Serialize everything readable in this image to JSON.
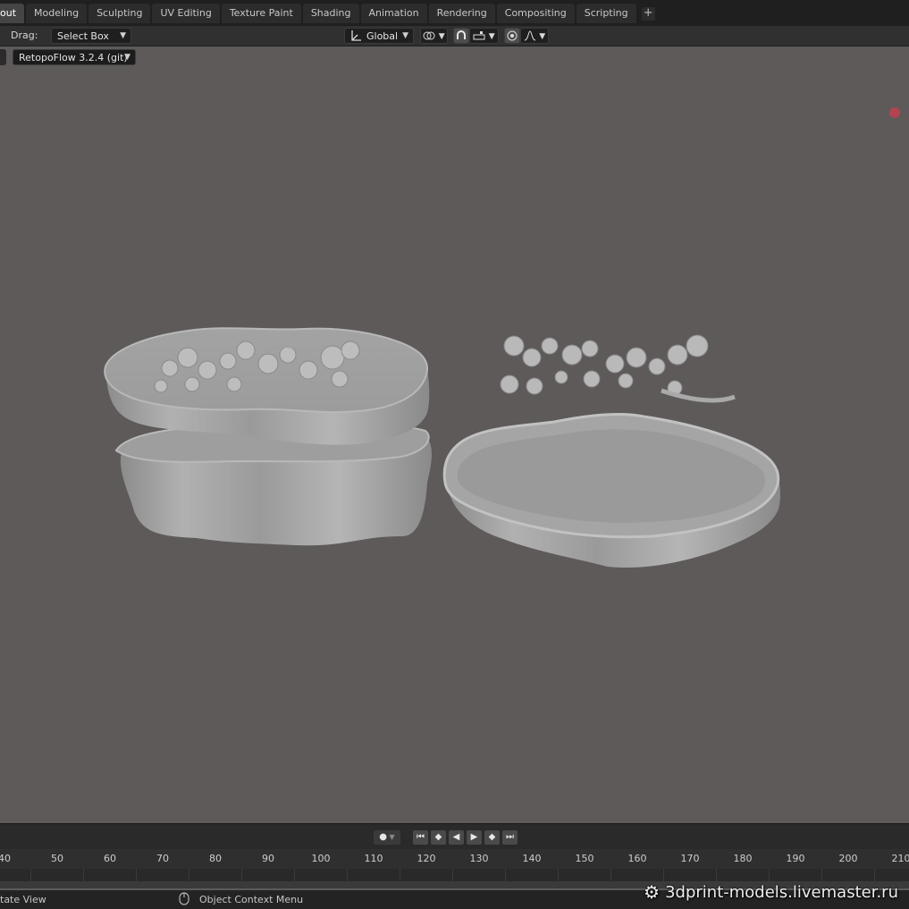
{
  "workspace_tabs": [
    {
      "label": "out",
      "active": true
    },
    {
      "label": "Modeling",
      "active": false
    },
    {
      "label": "Sculpting",
      "active": false
    },
    {
      "label": "UV Editing",
      "active": false
    },
    {
      "label": "Texture Paint",
      "active": false
    },
    {
      "label": "Shading",
      "active": false
    },
    {
      "label": "Animation",
      "active": false
    },
    {
      "label": "Rendering",
      "active": false
    },
    {
      "label": "Compositing",
      "active": false
    },
    {
      "label": "Scripting",
      "active": false
    }
  ],
  "add_tab_label": "+",
  "toolbar": {
    "drag_label": "Drag:",
    "drag_value": "Select Box",
    "orientation_value": "Global",
    "pivot_icon": "pivot-icon",
    "snap_icon": "magnet-icon",
    "proportional_icon": "proportional-icon"
  },
  "viewport": {
    "addon_value": "RetopoFlow 3.2.4 (git)",
    "background_color": "#5e5a5a",
    "record_indicator_color": "#b5434f"
  },
  "timeline": {
    "ruler_labels": [
      "40",
      "50",
      "60",
      "70",
      "80",
      "90",
      "100",
      "110",
      "120",
      "130",
      "140",
      "150",
      "160",
      "170",
      "180",
      "190",
      "200",
      "210"
    ],
    "playback_icons": [
      "jump-start-icon",
      "prev-keyframe-icon",
      "play-reverse-icon",
      "play-icon",
      "next-keyframe-icon",
      "jump-end-icon"
    ]
  },
  "statusbar": {
    "left_text": "tate View",
    "middle_text": "Object Context Menu"
  },
  "watermark": {
    "text": "3dprint-models.livemaster.ru"
  }
}
